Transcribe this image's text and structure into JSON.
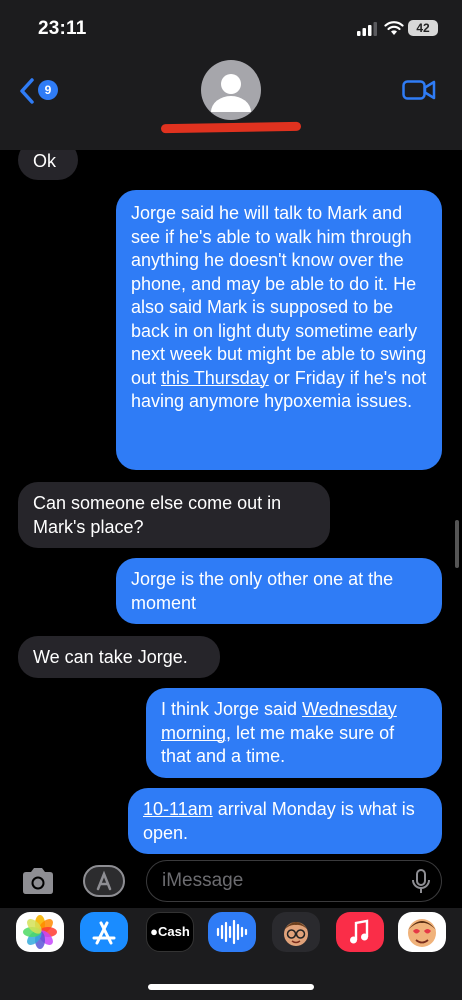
{
  "status": {
    "time": "23:11",
    "battery": "42"
  },
  "header": {
    "unread_count": "9"
  },
  "messages": [
    {
      "dir": "in",
      "text": "Ok"
    },
    {
      "dir": "out",
      "parts": [
        "Jorge said he will talk to Mark and see if he's able to walk him through anything he doesn't know over the phone, and may be able to do it. He also said Mark is supposed to be back in on light duty sometime early next week but might be able to swing out ",
        "this Thursday",
        " or Friday if he's not having anymore hypoxemia issues."
      ]
    },
    {
      "dir": "in",
      "text": "Can someone else come out in Mark's place?"
    },
    {
      "dir": "out",
      "text": "Jorge is the only other one at the moment"
    },
    {
      "dir": "in",
      "text": "We can take Jorge."
    },
    {
      "dir": "out",
      "parts": [
        "I think Jorge said ",
        "Wednesday morning",
        ", let me make sure of that and a time."
      ]
    },
    {
      "dir": "out",
      "parts": [
        "",
        "10-11am",
        " arrival Monday is what is open."
      ]
    }
  ],
  "composer": {
    "placeholder": "iMessage"
  },
  "tray": {
    "apps": [
      {
        "name": "Photos",
        "icon": "photos-icon",
        "color": "#ffffff"
      },
      {
        "name": "App Store",
        "icon": "app-store-icon",
        "color": "#1a8cff"
      },
      {
        "name": "Cash",
        "icon": "cash-icon",
        "label": "Cash",
        "color": "#000000"
      },
      {
        "name": "Audio",
        "icon": "audio-message-icon",
        "color": "#2f7cf6"
      },
      {
        "name": "Memoji",
        "icon": "memoji-icon",
        "color": "#2a2a2e"
      },
      {
        "name": "Music",
        "icon": "music-icon",
        "color": "#fa2d48"
      },
      {
        "name": "Memoji Stickers",
        "icon": "memoji-stickers-icon",
        "color": "#ffffff"
      }
    ]
  },
  "colors": {
    "outgoing": "#2f7cf6",
    "incoming": "#26252a",
    "redaction": "#e0321f"
  }
}
